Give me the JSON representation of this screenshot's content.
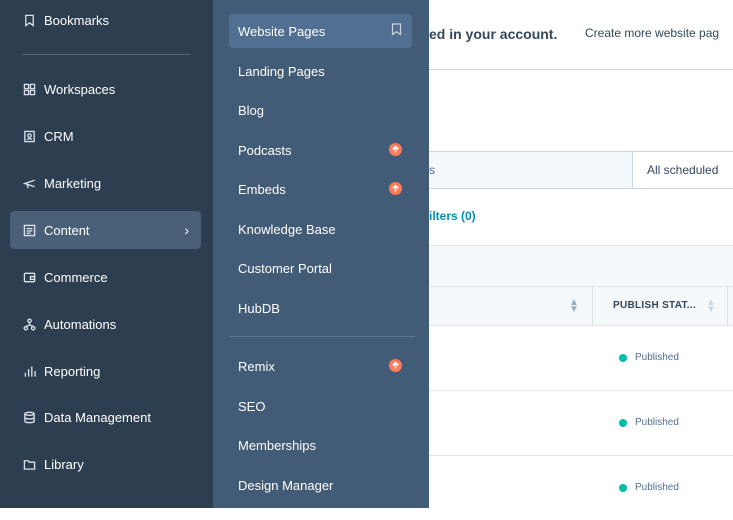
{
  "sidebar": {
    "items": [
      {
        "label": "Bookmarks",
        "icon": "bookmark-icon"
      },
      {
        "label": "Workspaces",
        "icon": "grid-icon"
      },
      {
        "label": "CRM",
        "icon": "contact-card-icon"
      },
      {
        "label": "Marketing",
        "icon": "megaphone-icon"
      },
      {
        "label": "Content",
        "icon": "content-icon",
        "active": true
      },
      {
        "label": "Commerce",
        "icon": "commerce-icon"
      },
      {
        "label": "Automations",
        "icon": "automations-icon"
      },
      {
        "label": "Reporting",
        "icon": "bar-chart-icon"
      },
      {
        "label": "Data Management",
        "icon": "database-icon"
      },
      {
        "label": "Library",
        "icon": "folder-icon"
      }
    ],
    "expand_glyph": "›"
  },
  "flyout": {
    "items": [
      {
        "label": "Website Pages",
        "active": true,
        "right": "bookmark-icon"
      },
      {
        "label": "Landing Pages"
      },
      {
        "label": "Blog"
      },
      {
        "label": "Podcasts",
        "right": "upgrade-arrow-icon"
      },
      {
        "label": "Embeds",
        "right": "upgrade-arrow-icon"
      },
      {
        "label": "Knowledge Base"
      },
      {
        "label": "Customer Portal"
      },
      {
        "label": "HubDB"
      },
      {
        "label": "Remix",
        "right": "upgrade-arrow-icon"
      },
      {
        "label": "SEO"
      },
      {
        "label": "Memberships"
      },
      {
        "label": "Design Manager"
      }
    ]
  },
  "main": {
    "banner_strong": "ed in your account.",
    "banner_light": "Create more website pag",
    "filter_fragment": "s",
    "scheduled_label": "All scheduled",
    "filters_link": "ilters (0)",
    "column_header": "PUBLISH STAT...",
    "rows": [
      {
        "status": "Published"
      },
      {
        "status": "Published"
      },
      {
        "status": "Published"
      }
    ]
  },
  "colors": {
    "sidebar_bg": "#2d3e50",
    "flyout_bg": "#425b76",
    "active_item": "#516f90",
    "upgrade_badge": "#ff7a59",
    "published_dot": "#00bda5",
    "link": "#0091ae"
  }
}
